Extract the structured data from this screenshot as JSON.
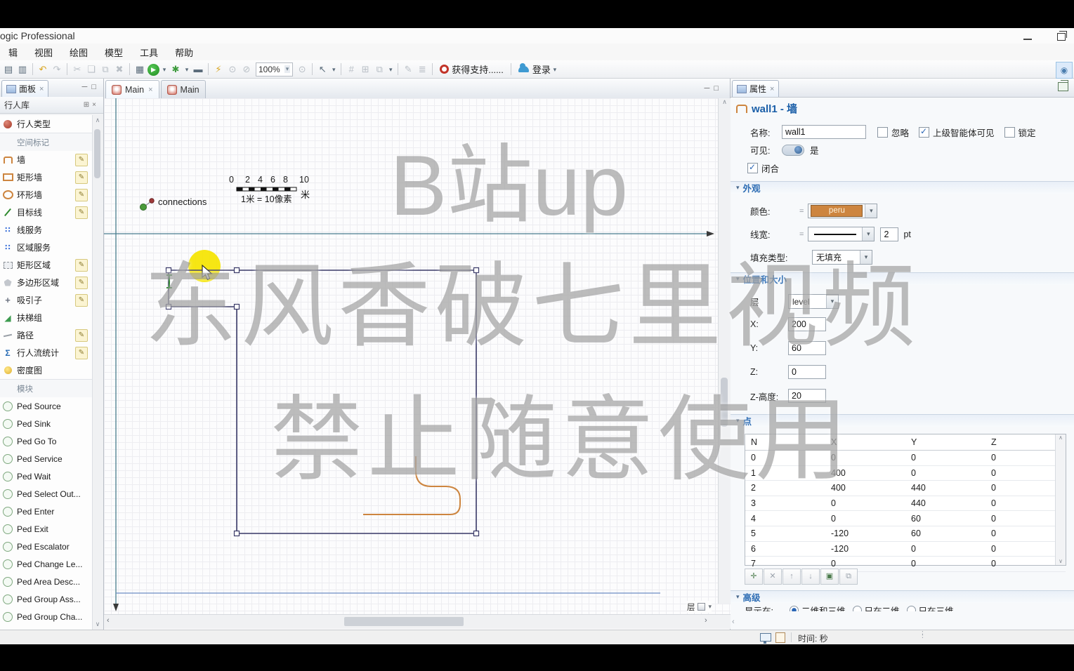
{
  "window": {
    "title": "ogic Professional"
  },
  "menu": {
    "items": [
      "辑",
      "视图",
      "绘图",
      "模型",
      "工具",
      "帮助"
    ]
  },
  "toolbar": {
    "zoom_value": "100%",
    "support_label": "获得支持......",
    "login_label": "登录",
    "items": [
      {
        "n": "save-icon",
        "g": "▤",
        "c": ""
      },
      {
        "n": "save-all-icon",
        "g": "▥",
        "c": ""
      },
      {
        "sep": true
      },
      {
        "n": "undo-icon",
        "g": "↶",
        "c": "c-yellow"
      },
      {
        "n": "redo-icon",
        "g": "↷",
        "c": "c-dim"
      },
      {
        "sep": true
      },
      {
        "n": "cut-icon",
        "g": "✂",
        "c": "c-dim"
      },
      {
        "n": "copy-icon",
        "g": "❏",
        "c": "c-dim"
      },
      {
        "n": "paste-icon",
        "g": "⧉",
        "c": "c-dim"
      },
      {
        "n": "delete-icon",
        "g": "✖",
        "c": "c-dim"
      },
      {
        "sep": true
      },
      {
        "n": "build-icon",
        "g": "▦",
        "c": ""
      },
      {
        "n": "run-icon",
        "g": "▶",
        "c": "c-run"
      },
      {
        "n": "run-dropdown-icon",
        "g": "▾",
        "c": "c-dd"
      },
      {
        "n": "debug-icon",
        "g": "✱",
        "c": "c-green"
      },
      {
        "n": "debug-dropdown-icon",
        "g": "▾",
        "c": "c-dd"
      },
      {
        "n": "presentation-icon",
        "g": "▬",
        "c": ""
      },
      {
        "sep": true
      },
      {
        "n": "highlight-icon",
        "g": "⚡",
        "c": "c-yellow"
      },
      {
        "n": "zoom-area-icon",
        "g": "⊙",
        "c": "c-dim"
      },
      {
        "n": "zoom-out-icon",
        "g": "⊘",
        "c": "c-dim"
      }
    ],
    "items2": [
      {
        "n": "magnifier-icon",
        "g": "⊙",
        "c": "c-dim"
      },
      {
        "sep": true
      },
      {
        "n": "pointer-icon",
        "g": "↖",
        "c": ""
      },
      {
        "n": "pointer-dropdown-icon",
        "g": "▾",
        "c": "c-dd"
      },
      {
        "sep": true
      },
      {
        "n": "grid-icon",
        "g": "#",
        "c": "c-dim"
      },
      {
        "n": "snap-icon",
        "g": "⊞",
        "c": "c-dim"
      },
      {
        "n": "copy-shape-icon",
        "g": "⧉",
        "c": "c-dim"
      },
      {
        "n": "shape-dropdown-icon",
        "g": "▾",
        "c": "c-dd"
      },
      {
        "sep": true
      },
      {
        "n": "draw-mode-icon",
        "g": "✎",
        "c": "c-dim"
      },
      {
        "n": "levels-icon",
        "g": "≣",
        "c": "c-dim"
      }
    ]
  },
  "glyphs": {
    "close": "×",
    "chevron_down": "▾",
    "arrow_up": "∧",
    "arrow_down": "∨",
    "arrow_left": "‹",
    "arrow_right": "›",
    "eq": "=",
    "pane_min": "─",
    "pane_max": "□",
    "grid_btn": "⊞",
    "detach": "⌑",
    "globe": "◉"
  },
  "panel": {
    "tab_label": "面板",
    "library_title": "行人库",
    "items": [
      {
        "cls": "item",
        "icon": "icn-ped",
        "label": "行人类型",
        "n": "palette-item-pedestrian-type"
      },
      {
        "cls": "section",
        "label": "空间标记",
        "n": "palette-section-space-markup"
      },
      {
        "cls": "item",
        "icon": "icn-wall",
        "label": "墙",
        "pencil": true,
        "n": "palette-item-wall"
      },
      {
        "cls": "item",
        "icon": "icn-rectwall",
        "label": "矩形墙",
        "pencil": true,
        "n": "palette-item-rect-wall"
      },
      {
        "cls": "item",
        "icon": "icn-ringwall",
        "label": "环形墙",
        "pencil": true,
        "n": "palette-item-ring-wall"
      },
      {
        "cls": "item",
        "icon": "icn-target",
        "label": "目标线",
        "pencil": true,
        "n": "palette-item-target-line"
      },
      {
        "cls": "item",
        "icon": "icn-lineserv",
        "g": "∷",
        "label": "线服务",
        "n": "palette-item-line-service"
      },
      {
        "cls": "item",
        "icon": "icn-areaserv",
        "g": "∷",
        "label": "区域服务",
        "n": "palette-item-area-service"
      },
      {
        "cls": "item",
        "icon": "icn-rectarea",
        "label": "矩形区域",
        "pencil": true,
        "n": "palette-item-rect-area"
      },
      {
        "cls": "item",
        "icon": "icn-polyarea",
        "label": "多边形区域",
        "pencil": true,
        "n": "palette-item-poly-area"
      },
      {
        "cls": "item",
        "icon": "icn-attract",
        "g": "+",
        "label": "吸引子",
        "pencil": true,
        "n": "palette-item-attractor"
      },
      {
        "cls": "item",
        "icon": "icn-esc",
        "g": "◢",
        "label": "扶梯组",
        "n": "palette-item-escalator-group"
      },
      {
        "cls": "item",
        "icon": "icn-path",
        "label": "路径",
        "pencil": true,
        "n": "palette-item-pathway"
      },
      {
        "cls": "item",
        "icon": "icn-stats",
        "g": "Σ",
        "label": "行人流统计",
        "pencil": true,
        "n": "palette-item-ped-flow-stats"
      },
      {
        "cls": "item",
        "icon": "icn-density",
        "label": "密度图",
        "n": "palette-item-density-map"
      },
      {
        "cls": "section",
        "label": "模块",
        "n": "palette-section-blocks"
      },
      {
        "cls": "item",
        "icon": "icn-module",
        "label": "Ped Source",
        "n": "palette-item-ped-source"
      },
      {
        "cls": "item",
        "icon": "icn-module",
        "label": "Ped Sink",
        "n": "palette-item-ped-sink"
      },
      {
        "cls": "item",
        "icon": "icn-module",
        "label": "Ped Go To",
        "n": "palette-item-ped-go-to"
      },
      {
        "cls": "item",
        "icon": "icn-module",
        "label": "Ped Service",
        "n": "palette-item-ped-service"
      },
      {
        "cls": "item",
        "icon": "icn-module",
        "label": "Ped Wait",
        "n": "palette-item-ped-wait"
      },
      {
        "cls": "item",
        "icon": "icn-module",
        "label": "Ped Select Out...",
        "n": "palette-item-ped-select-output"
      },
      {
        "cls": "item",
        "icon": "icn-module",
        "label": "Ped Enter",
        "n": "palette-item-ped-enter"
      },
      {
        "cls": "item",
        "icon": "icn-module",
        "label": "Ped Exit",
        "n": "palette-item-ped-exit"
      },
      {
        "cls": "item",
        "icon": "icn-module",
        "label": "Ped Escalator",
        "n": "palette-item-ped-escalator"
      },
      {
        "cls": "item",
        "icon": "icn-module",
        "label": "Ped Change Le...",
        "n": "palette-item-ped-change-level"
      },
      {
        "cls": "item",
        "icon": "icn-module",
        "label": "Ped Area Desc...",
        "n": "palette-item-ped-area-descriptor"
      },
      {
        "cls": "item",
        "icon": "icn-module",
        "label": "Ped Group Ass...",
        "n": "palette-item-ped-group-assemble"
      },
      {
        "cls": "item",
        "icon": "icn-module",
        "label": "Ped Group Cha...",
        "n": "palette-item-ped-group-change"
      }
    ]
  },
  "editor": {
    "tabs": [
      {
        "label": "Main",
        "cls": "active",
        "close": true,
        "n": "tab-main-1"
      },
      {
        "label": "Main",
        "cls": "",
        "close": false,
        "n": "tab-main-2"
      }
    ],
    "scale": {
      "ticks": [
        "0",
        "2",
        "4",
        "6",
        "8",
        "10"
      ],
      "caption": "1米 = 10像素",
      "unit": "米"
    },
    "connections_label": "connections",
    "layer_label": "层"
  },
  "watermark": {
    "line1": "B站up",
    "line2": "东风香破七里视频",
    "line3": "禁止随意使用"
  },
  "properties": {
    "tab_label": "属性",
    "header": "wall1 - 墙",
    "name_label": "名称:",
    "name_value": "wall1",
    "checkbox_ignore": "忽略",
    "checkbox_parent_visible": "上级智能体可见",
    "checkbox_lock": "锁定",
    "visible_label": "可见:",
    "visible_value": "是",
    "closed_label": "闭合",
    "appearance": {
      "title": "外观",
      "color_label": "颜色:",
      "color_value": "peru",
      "color_hex": "#cd853f",
      "linewidth_label": "线宽:",
      "linewidth_value": "2",
      "linewidth_unit": "pt",
      "fill_label": "填充类型:",
      "fill_value": "无填充"
    },
    "position": {
      "title": "位置和大小",
      "layer_label": "层",
      "layer_value": "level",
      "x_label": "X:",
      "x_value": "200",
      "y_label": "Y:",
      "y_value": "60",
      "z_label": "Z:",
      "z_value": "0",
      "zheight_label": "Z-高度:",
      "zheight_value": "20"
    },
    "points": {
      "title": "点",
      "columns": [
        "N",
        "X",
        "Y",
        "Z"
      ],
      "rows": [
        [
          "0",
          "0",
          "0",
          "0"
        ],
        [
          "1",
          "400",
          "0",
          "0"
        ],
        [
          "2",
          "400",
          "440",
          "0"
        ],
        [
          "3",
          "0",
          "440",
          "0"
        ],
        [
          "4",
          "0",
          "60",
          "0"
        ],
        [
          "5",
          "-120",
          "60",
          "0"
        ],
        [
          "6",
          "-120",
          "0",
          "0"
        ],
        [
          "7",
          "0",
          "0",
          "0"
        ]
      ],
      "buttons": [
        {
          "n": "add-point-button",
          "g": "✛",
          "c": "en"
        },
        {
          "n": "delete-point-button",
          "g": "✕",
          "c": ""
        },
        {
          "n": "move-point-up-button",
          "g": "↑",
          "c": ""
        },
        {
          "n": "move-point-down-button",
          "g": "↓",
          "c": ""
        },
        {
          "n": "paste-points-button",
          "g": "▣",
          "c": "en"
        },
        {
          "n": "copy-points-button",
          "g": "⧉",
          "c": ""
        }
      ]
    },
    "advanced": {
      "title": "高级",
      "show_label": "显示在:",
      "options": [
        {
          "label": "二维和三维",
          "cls": "sel"
        },
        {
          "label": "只在二维",
          "cls": ""
        },
        {
          "label": "只在三维",
          "cls": ""
        }
      ]
    }
  },
  "statusbar": {
    "time_label": "时间:",
    "time_unit": "秒"
  }
}
